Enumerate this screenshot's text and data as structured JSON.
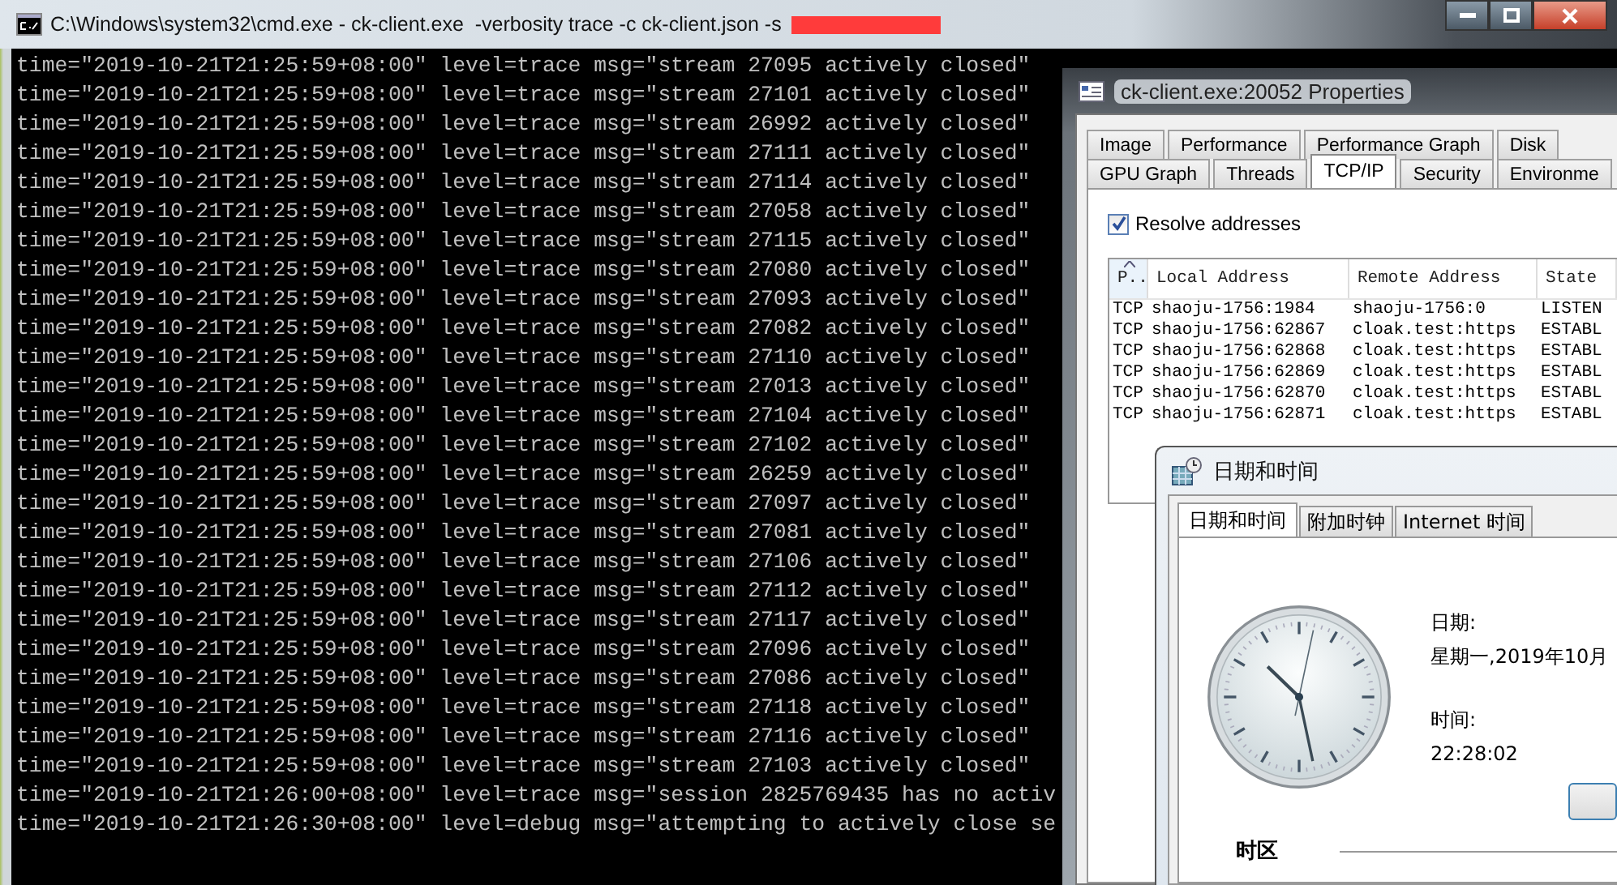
{
  "console": {
    "title": "C:\\Windows\\system32\\cmd.exe - ck-client.exe  -verbosity trace -c ck-client.json -s",
    "lines": [
      "time=\"2019-10-21T21:25:59+08:00\" level=trace msg=\"stream 27095 actively closed\"",
      "time=\"2019-10-21T21:25:59+08:00\" level=trace msg=\"stream 27101 actively closed\"",
      "time=\"2019-10-21T21:25:59+08:00\" level=trace msg=\"stream 26992 actively closed\"",
      "time=\"2019-10-21T21:25:59+08:00\" level=trace msg=\"stream 27111 actively closed\"",
      "time=\"2019-10-21T21:25:59+08:00\" level=trace msg=\"stream 27114 actively closed\"",
      "time=\"2019-10-21T21:25:59+08:00\" level=trace msg=\"stream 27058 actively closed\"",
      "time=\"2019-10-21T21:25:59+08:00\" level=trace msg=\"stream 27115 actively closed\"",
      "time=\"2019-10-21T21:25:59+08:00\" level=trace msg=\"stream 27080 actively closed\"",
      "time=\"2019-10-21T21:25:59+08:00\" level=trace msg=\"stream 27093 actively closed\"",
      "time=\"2019-10-21T21:25:59+08:00\" level=trace msg=\"stream 27082 actively closed\"",
      "time=\"2019-10-21T21:25:59+08:00\" level=trace msg=\"stream 27110 actively closed\"",
      "time=\"2019-10-21T21:25:59+08:00\" level=trace msg=\"stream 27013 actively closed\"",
      "time=\"2019-10-21T21:25:59+08:00\" level=trace msg=\"stream 27104 actively closed\"",
      "time=\"2019-10-21T21:25:59+08:00\" level=trace msg=\"stream 27102 actively closed\"",
      "time=\"2019-10-21T21:25:59+08:00\" level=trace msg=\"stream 26259 actively closed\"",
      "time=\"2019-10-21T21:25:59+08:00\" level=trace msg=\"stream 27097 actively closed\"",
      "time=\"2019-10-21T21:25:59+08:00\" level=trace msg=\"stream 27081 actively closed\"",
      "time=\"2019-10-21T21:25:59+08:00\" level=trace msg=\"stream 27106 actively closed\"",
      "time=\"2019-10-21T21:25:59+08:00\" level=trace msg=\"stream 27112 actively closed\"",
      "time=\"2019-10-21T21:25:59+08:00\" level=trace msg=\"stream 27117 actively closed\"",
      "time=\"2019-10-21T21:25:59+08:00\" level=trace msg=\"stream 27096 actively closed\"",
      "time=\"2019-10-21T21:25:59+08:00\" level=trace msg=\"stream 27086 actively closed\"",
      "time=\"2019-10-21T21:25:59+08:00\" level=trace msg=\"stream 27118 actively closed\"",
      "time=\"2019-10-21T21:25:59+08:00\" level=trace msg=\"stream 27116 actively closed\"",
      "time=\"2019-10-21T21:25:59+08:00\" level=trace msg=\"stream 27103 actively closed\"",
      "time=\"2019-10-21T21:26:00+08:00\" level=trace msg=\"session 2825769435 has no activ",
      "time=\"2019-10-21T21:26:30+08:00\" level=debug msg=\"attempting to actively close se"
    ]
  },
  "properties": {
    "title": "ck-client.exe:20052 Properties",
    "tab_rows": [
      [
        {
          "label": "Image",
          "selected": false
        },
        {
          "label": "Performance",
          "selected": false
        },
        {
          "label": "Performance Graph",
          "selected": false
        },
        {
          "label": "Disk",
          "selected": false
        }
      ],
      [
        {
          "label": "GPU Graph",
          "selected": false
        },
        {
          "label": "Threads",
          "selected": false
        },
        {
          "label": "TCP/IP",
          "selected": true
        },
        {
          "label": "Security",
          "selected": false
        },
        {
          "label": "Environme",
          "selected": false
        }
      ]
    ],
    "resolve_addresses": {
      "label": "Resolve addresses",
      "checked": true
    },
    "table": {
      "columns": [
        {
          "label": "P..",
          "sorted": true
        },
        {
          "label": "Local Address",
          "sorted": false
        },
        {
          "label": "Remote Address",
          "sorted": false
        },
        {
          "label": "State",
          "sorted": false
        }
      ],
      "rows": [
        [
          "TCP",
          "shaoju-1756:1984",
          "shaoju-1756:0",
          "LISTEN"
        ],
        [
          "TCP",
          "shaoju-1756:62867",
          "cloak.test:https",
          "ESTABL"
        ],
        [
          "TCP",
          "shaoju-1756:62868",
          "cloak.test:https",
          "ESTABL"
        ],
        [
          "TCP",
          "shaoju-1756:62869",
          "cloak.test:https",
          "ESTABL"
        ],
        [
          "TCP",
          "shaoju-1756:62870",
          "cloak.test:https",
          "ESTABL"
        ],
        [
          "TCP",
          "shaoju-1756:62871",
          "cloak.test:https",
          "ESTABL"
        ]
      ]
    }
  },
  "datetime": {
    "title": "日期和时间",
    "tabs": [
      {
        "label": "日期和时间",
        "selected": true
      },
      {
        "label": "附加时钟",
        "selected": false
      },
      {
        "label": "Internet 时间",
        "selected": false
      }
    ],
    "date_label": "日期:",
    "date": "星期一,2019年10月",
    "time_label": "时间:",
    "time": "22:28:02",
    "timezone_label": "时区"
  }
}
